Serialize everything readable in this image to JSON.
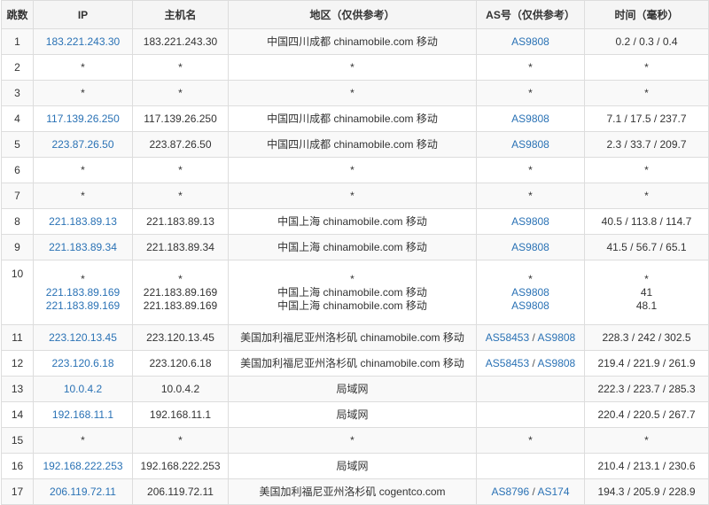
{
  "headers": {
    "hop": "跳数",
    "ip": "IP",
    "host": "主机名",
    "region": "地区（仅供参考）",
    "as": "AS号（仅供参考）",
    "time": "时间（毫秒）"
  },
  "rows": [
    {
      "hop": "1",
      "lines": [
        {
          "ip": "183.221.243.30",
          "host": "183.221.243.30",
          "region": "中国四川成都 chinamobile.com 移动",
          "as": [
            "AS9808"
          ],
          "time": "0.2 / 0.3 / 0.4"
        }
      ]
    },
    {
      "hop": "2",
      "lines": [
        {
          "ip": "*",
          "host": "*",
          "region": "*",
          "as_text": "*",
          "time": "*"
        }
      ]
    },
    {
      "hop": "3",
      "lines": [
        {
          "ip": "*",
          "host": "*",
          "region": "*",
          "as_text": "*",
          "time": "*"
        }
      ]
    },
    {
      "hop": "4",
      "lines": [
        {
          "ip": "117.139.26.250",
          "host": "117.139.26.250",
          "region": "中国四川成都 chinamobile.com 移动",
          "as": [
            "AS9808"
          ],
          "time": "7.1 / 17.5 / 237.7"
        }
      ]
    },
    {
      "hop": "5",
      "lines": [
        {
          "ip": "223.87.26.50",
          "host": "223.87.26.50",
          "region": "中国四川成都 chinamobile.com 移动",
          "as": [
            "AS9808"
          ],
          "time": "2.3 / 33.7 / 209.7"
        }
      ]
    },
    {
      "hop": "6",
      "lines": [
        {
          "ip": "*",
          "host": "*",
          "region": "*",
          "as_text": "*",
          "time": "*"
        }
      ]
    },
    {
      "hop": "7",
      "lines": [
        {
          "ip": "*",
          "host": "*",
          "region": "*",
          "as_text": "*",
          "time": "*"
        }
      ]
    },
    {
      "hop": "8",
      "lines": [
        {
          "ip": "221.183.89.13",
          "host": "221.183.89.13",
          "region": "中国上海 chinamobile.com 移动",
          "as": [
            "AS9808"
          ],
          "time": "40.5 / 113.8 / 114.7"
        }
      ]
    },
    {
      "hop": "9",
      "lines": [
        {
          "ip": "221.183.89.34",
          "host": "221.183.89.34",
          "region": "中国上海 chinamobile.com 移动",
          "as": [
            "AS9808"
          ],
          "time": "41.5 / 56.7 / 65.1"
        }
      ]
    },
    {
      "hop": "10",
      "lines": [
        {
          "ip": "*",
          "host": "*",
          "region": "*",
          "as_text": "*",
          "time": "*"
        },
        {
          "ip": "221.183.89.169",
          "host": "221.183.89.169",
          "region": "中国上海 chinamobile.com 移动",
          "as": [
            "AS9808"
          ],
          "time": "41"
        },
        {
          "ip": "221.183.89.169",
          "host": "221.183.89.169",
          "region": "中国上海 chinamobile.com 移动",
          "as": [
            "AS9808"
          ],
          "time": "48.1"
        }
      ]
    },
    {
      "hop": "11",
      "lines": [
        {
          "ip": "223.120.13.45",
          "host": "223.120.13.45",
          "region": "美国加利福尼亚州洛杉矶 chinamobile.com 移动",
          "as": [
            "AS58453",
            "AS9808"
          ],
          "time": "228.3 / 242 / 302.5"
        }
      ]
    },
    {
      "hop": "12",
      "lines": [
        {
          "ip": "223.120.6.18",
          "host": "223.120.6.18",
          "region": "美国加利福尼亚州洛杉矶 chinamobile.com 移动",
          "as": [
            "AS58453",
            "AS9808"
          ],
          "time": "219.4 / 221.9 / 261.9"
        }
      ]
    },
    {
      "hop": "13",
      "lines": [
        {
          "ip": "10.0.4.2",
          "host": "10.0.4.2",
          "region": "局域网",
          "as_text": "",
          "time": "222.3 / 223.7 / 285.3"
        }
      ]
    },
    {
      "hop": "14",
      "lines": [
        {
          "ip": "192.168.11.1",
          "host": "192.168.11.1",
          "region": "局域网",
          "as_text": "",
          "time": "220.4 / 220.5 / 267.7"
        }
      ]
    },
    {
      "hop": "15",
      "lines": [
        {
          "ip": "*",
          "host": "*",
          "region": "*",
          "as_text": "*",
          "time": "*"
        }
      ]
    },
    {
      "hop": "16",
      "lines": [
        {
          "ip": "192.168.222.253",
          "host": "192.168.222.253",
          "region": "局域网",
          "as_text": "",
          "time": "210.4 / 213.1 / 230.6"
        }
      ]
    },
    {
      "hop": "17",
      "lines": [
        {
          "ip": "206.119.72.11",
          "host": "206.119.72.11",
          "region": "美国加利福尼亚州洛杉矶 cogentco.com",
          "as": [
            "AS8796",
            "AS174"
          ],
          "time": "194.3 / 205.9 / 228.9"
        }
      ]
    }
  ],
  "as_separator": " / "
}
